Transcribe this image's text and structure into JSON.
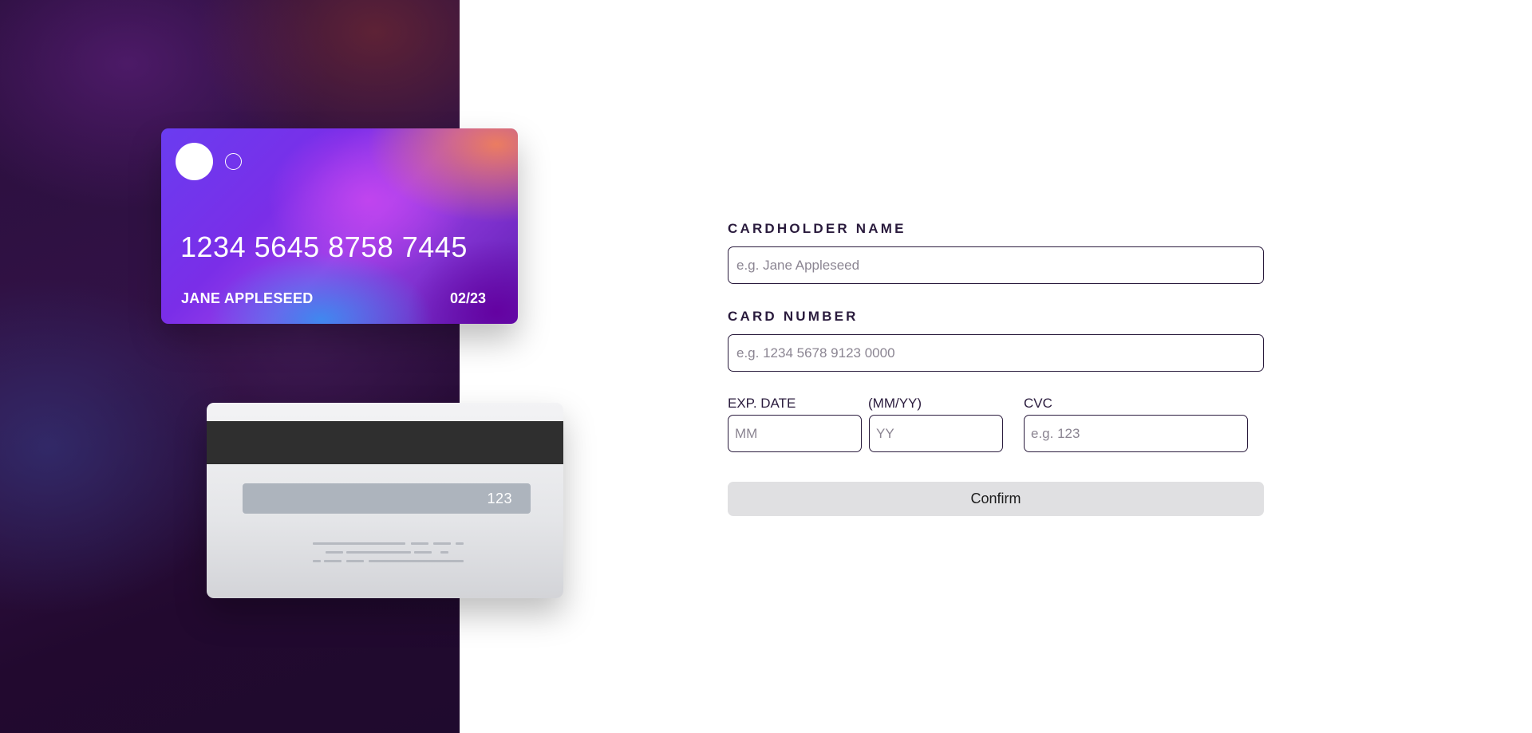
{
  "card_front": {
    "number": "1234 5645 8758 7445",
    "holder_name": "JANE APPLESEED",
    "expiry": "02/23"
  },
  "card_back": {
    "cvc": "123"
  },
  "form": {
    "cardholder_label": "CARDHOLDER NAME",
    "cardholder_placeholder": "e.g. Jane Appleseed",
    "cardholder_value": "",
    "card_number_label": "CARD NUMBER",
    "card_number_placeholder": "e.g. 1234 5678 9123 0000",
    "card_number_value": "",
    "exp_label": "EXP. DATE",
    "exp_format_label": "(MM/YY)",
    "month_placeholder": "MM",
    "month_value": "",
    "year_placeholder": "YY",
    "year_value": "",
    "cvc_label": "CVC",
    "cvc_placeholder": "e.g. 123",
    "cvc_value": "",
    "confirm_label": "Confirm"
  },
  "colors": {
    "dark_text": "#2a1b3d",
    "button_bg": "#e0e0e2",
    "panel_bg": "#2a0f3d"
  }
}
